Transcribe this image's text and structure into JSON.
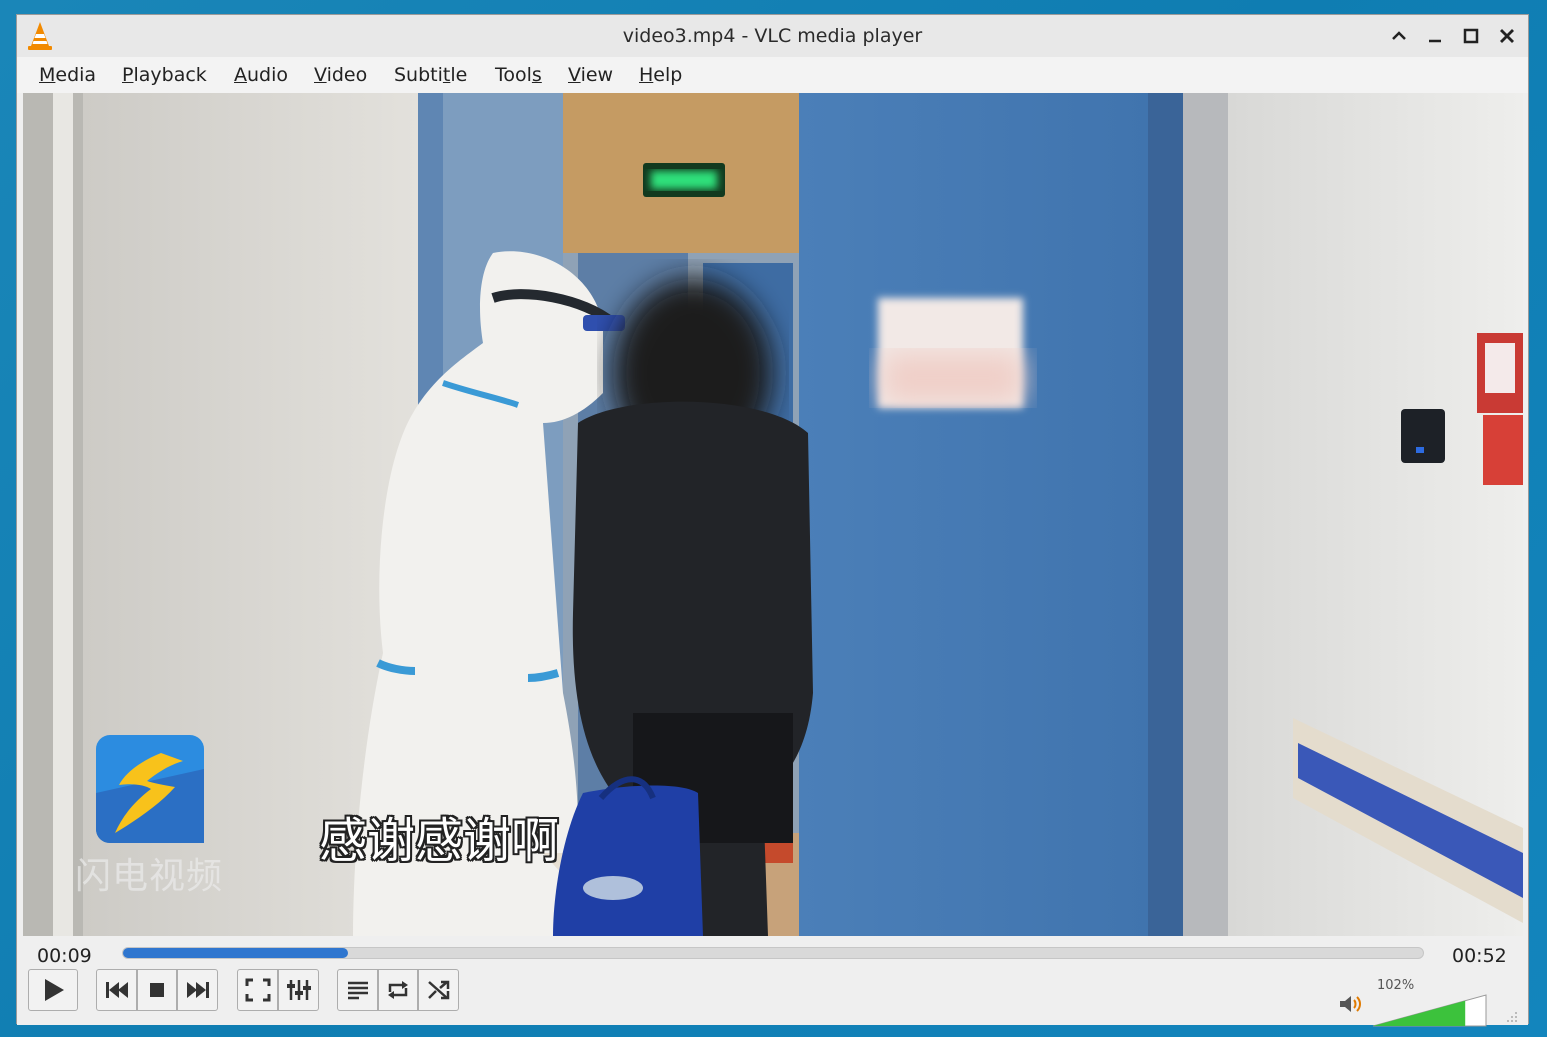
{
  "window": {
    "title": "video3.mp4 - VLC media player"
  },
  "menu": [
    {
      "label": "Media",
      "underline": "M",
      "rest": "edia"
    },
    {
      "label": "Playback",
      "underline": "P",
      "rest": "layback"
    },
    {
      "label": "Audio",
      "underline": "A",
      "rest": "udio"
    },
    {
      "label": "Video",
      "underline": "V",
      "rest": "ideo"
    },
    {
      "label": "Subtitle",
      "pre": "Subti",
      "underline": "t",
      "rest": "le"
    },
    {
      "label": "Tools",
      "pre": "Tool",
      "underline": "s",
      "rest": ""
    },
    {
      "label": "View",
      "underline": "V",
      "rest": "iew"
    },
    {
      "label": "Help",
      "underline": "H",
      "rest": "elp"
    }
  ],
  "video": {
    "subtitle": "感谢感谢啊",
    "watermark": "闪电视频"
  },
  "playback": {
    "elapsed": "00:09",
    "total": "00:52",
    "progress_fraction": 0.173
  },
  "volume": {
    "label": "102%",
    "level_percent": 102
  },
  "colors": {
    "accent": "#2f76cf",
    "volume_green": "#3cc23c",
    "vlc_orange": "#f28a00"
  }
}
